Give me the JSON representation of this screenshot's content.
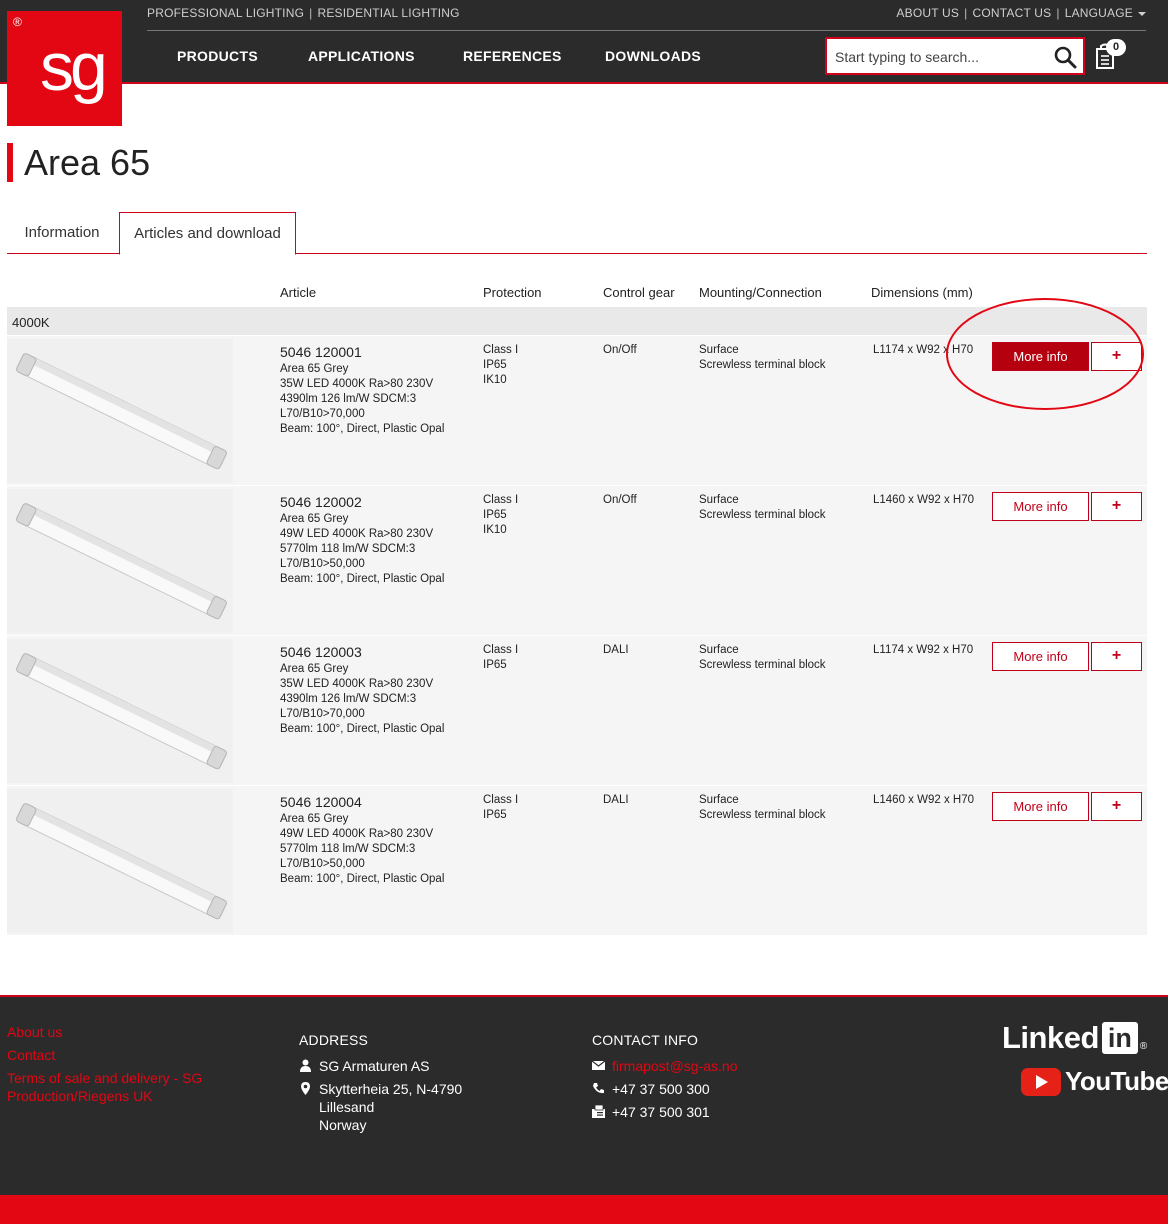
{
  "header": {
    "logo_text": "sg",
    "logo_registered": "®",
    "top_left_links": [
      "PROFESSIONAL LIGHTING",
      "RESIDENTIAL LIGHTING"
    ],
    "top_right_links": [
      "ABOUT US",
      "CONTACT US",
      "LANGUAGE"
    ],
    "separator": "|",
    "main_nav": [
      "PRODUCTS",
      "APPLICATIONS",
      "REFERENCES",
      "DOWNLOADS"
    ],
    "search_placeholder": "Start typing to search...",
    "cart_count": "0"
  },
  "page": {
    "title": "Area 65",
    "tabs": [
      "Information",
      "Articles and download"
    ],
    "active_tab": "Articles and download"
  },
  "table": {
    "headers": [
      "Article",
      "Protection",
      "Control gear",
      "Mounting/Connection",
      "Dimensions (mm)"
    ],
    "group": "4000K",
    "more_info_label": "More info",
    "add_label": "+",
    "rows": [
      {
        "number": "5046 120001",
        "name": "Area 65 Grey",
        "spec": "35W LED 4000K Ra>80 230V",
        "lumen": "4390lm 126 lm/W SDCM:3",
        "life": "L70/B10>70,000",
        "beam": "Beam: 100°, Direct, Plastic Opal",
        "protection": [
          "Class I",
          "IP65",
          "IK10"
        ],
        "control": "On/Off",
        "mounting": [
          "Surface",
          "Screwless terminal block"
        ],
        "dimensions": "L1174 x W92 x H70"
      },
      {
        "number": "5046 120002",
        "name": "Area 65 Grey",
        "spec": "49W LED 4000K Ra>80 230V",
        "lumen": "5770lm 118 lm/W SDCM:3",
        "life": "L70/B10>50,000",
        "beam": "Beam: 100°, Direct, Plastic Opal",
        "protection": [
          "Class I",
          "IP65",
          "IK10"
        ],
        "control": "On/Off",
        "mounting": [
          "Surface",
          "Screwless terminal block"
        ],
        "dimensions": "L1460 x W92 x H70"
      },
      {
        "number": "5046 120003",
        "name": "Area 65 Grey",
        "spec": "35W LED 4000K Ra>80 230V",
        "lumen": "4390lm 126 lm/W SDCM:3",
        "life": "L70/B10>70,000",
        "beam": "Beam: 100°, Direct, Plastic Opal",
        "protection": [
          "Class I",
          "IP65",
          ""
        ],
        "control": "DALI",
        "mounting": [
          "Surface",
          "Screwless terminal block"
        ],
        "dimensions": "L1174 x W92 x H70"
      },
      {
        "number": "5046 120004",
        "name": "Area 65 Grey",
        "spec": "49W LED 4000K Ra>80 230V",
        "lumen": "5770lm 118 lm/W SDCM:3",
        "life": "L70/B10>50,000",
        "beam": "Beam: 100°, Direct, Plastic Opal",
        "protection": [
          "Class I",
          "IP65",
          ""
        ],
        "control": "DALI",
        "mounting": [
          "Surface",
          "Screwless terminal block"
        ],
        "dimensions": "L1460 x W92 x H70"
      }
    ]
  },
  "footer": {
    "links": [
      "About us",
      "Contact",
      "Terms of sale and delivery - SG Production/Riegens UK"
    ],
    "address_heading": "ADDRESS",
    "company": "SG Armaturen AS",
    "address": "Skytterheia 25, N-4790\nLillesand\nNorway",
    "contact_heading": "CONTACT INFO",
    "email": "firmapost@sg-as.no",
    "phone": "+47 37 500 300",
    "fax": "+47 37 500 301",
    "linkedin_text": "Linked",
    "linkedin_in": "in",
    "youtube_text": "YouTube"
  },
  "colors": {
    "brand_red": "#e30613",
    "dark_bg": "#2b2b2b",
    "button_red": "#c00018"
  }
}
